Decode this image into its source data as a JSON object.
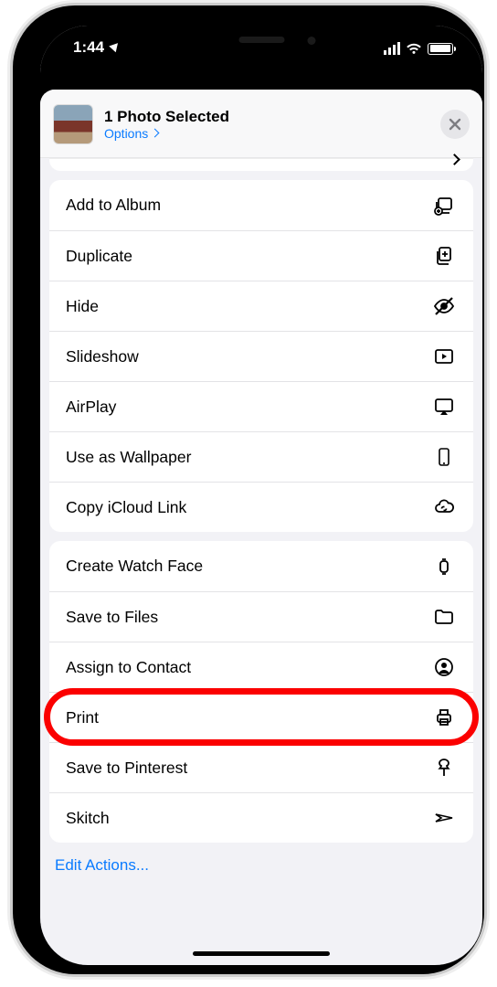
{
  "status": {
    "time": "1:44"
  },
  "header": {
    "title": "1 Photo Selected",
    "options_label": "Options"
  },
  "groups": [
    {
      "items": [
        {
          "key": "add-to-album",
          "label": "Add to Album",
          "icon": "add-album-icon"
        },
        {
          "key": "duplicate",
          "label": "Duplicate",
          "icon": "duplicate-icon"
        },
        {
          "key": "hide",
          "label": "Hide",
          "icon": "hide-icon"
        },
        {
          "key": "slideshow",
          "label": "Slideshow",
          "icon": "slideshow-icon"
        },
        {
          "key": "airplay",
          "label": "AirPlay",
          "icon": "airplay-icon"
        },
        {
          "key": "use-as-wallpaper",
          "label": "Use as Wallpaper",
          "icon": "wallpaper-icon"
        },
        {
          "key": "copy-icloud-link",
          "label": "Copy iCloud Link",
          "icon": "icloud-link-icon"
        }
      ]
    },
    {
      "items": [
        {
          "key": "create-watch-face",
          "label": "Create Watch Face",
          "icon": "watch-icon"
        },
        {
          "key": "save-to-files",
          "label": "Save to Files",
          "icon": "folder-icon"
        },
        {
          "key": "assign-to-contact",
          "label": "Assign to Contact",
          "icon": "contact-icon"
        },
        {
          "key": "print",
          "label": "Print",
          "icon": "printer-icon",
          "highlighted": true
        },
        {
          "key": "save-to-pinterest",
          "label": "Save to Pinterest",
          "icon": "pin-icon"
        },
        {
          "key": "skitch",
          "label": "Skitch",
          "icon": "skitch-icon"
        }
      ]
    }
  ],
  "edit_actions_label": "Edit Actions..."
}
